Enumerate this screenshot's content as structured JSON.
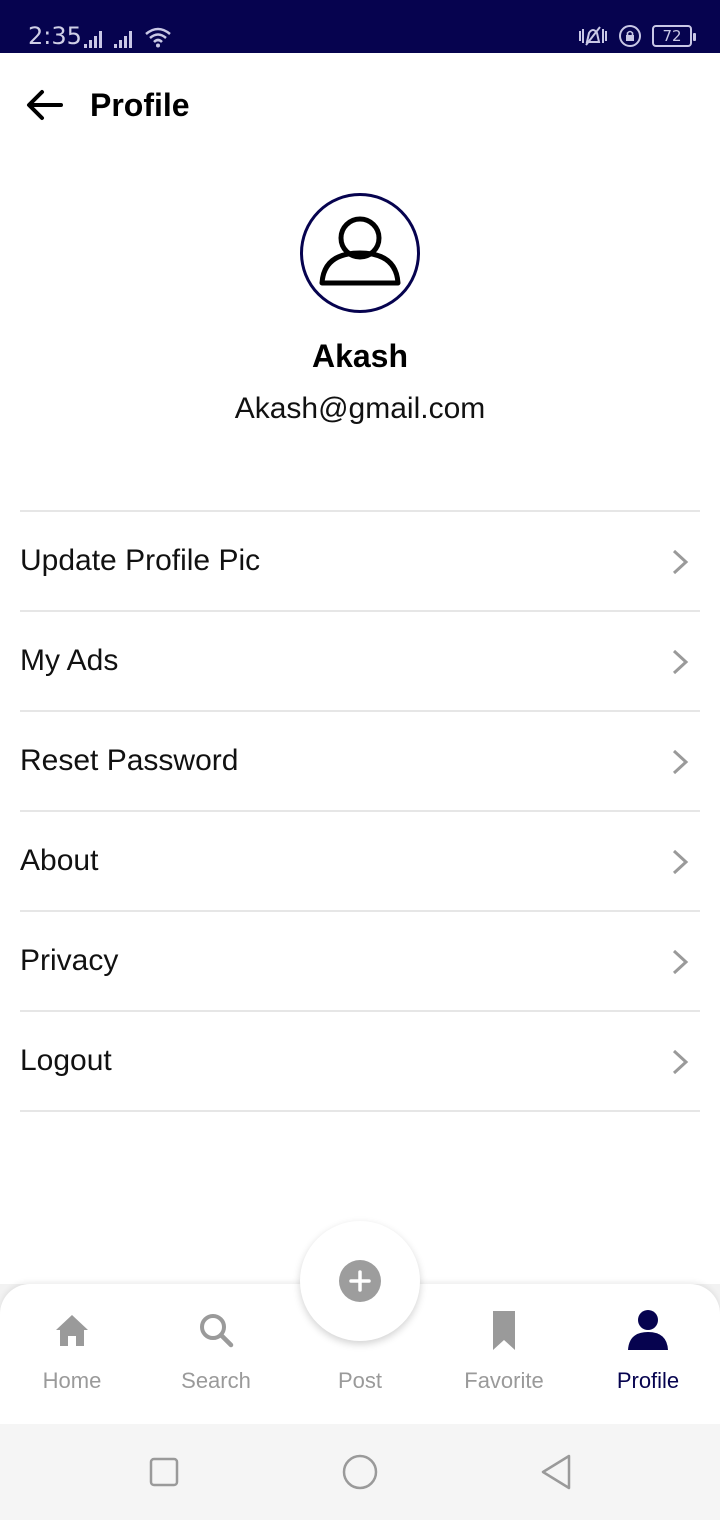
{
  "status_bar": {
    "time": "2:35",
    "battery": "72",
    "background_color": "#06034f",
    "icons": [
      "signal-icon",
      "signal-icon",
      "wifi-icon",
      "vibrate-icon",
      "rotation-lock-icon",
      "battery-icon"
    ]
  },
  "app_bar": {
    "title": "Profile",
    "back_icon": "back-arrow-icon"
  },
  "profile": {
    "name": "Akash",
    "email": "Akash@gmail.com",
    "avatar_icon": "user-icon",
    "avatar_border_color": "#06034f"
  },
  "menu": {
    "items": [
      {
        "label": "Update Profile Pic"
      },
      {
        "label": "My Ads"
      },
      {
        "label": "Reset Password"
      },
      {
        "label": "About"
      },
      {
        "label": "Privacy"
      },
      {
        "label": "Logout"
      }
    ]
  },
  "bottom_nav": {
    "active": "Profile",
    "active_color": "#06034f",
    "inactive_color": "#9a9a9a",
    "items": [
      {
        "label": "Home",
        "icon": "home-icon"
      },
      {
        "label": "Search",
        "icon": "search-icon"
      },
      {
        "label": "Post",
        "icon": "plus-icon"
      },
      {
        "label": "Favorite",
        "icon": "bookmark-icon"
      },
      {
        "label": "Profile",
        "icon": "person-icon"
      }
    ]
  },
  "system_nav": {
    "icons": [
      "recent-apps-icon",
      "home-circle-icon",
      "back-triangle-icon"
    ]
  }
}
